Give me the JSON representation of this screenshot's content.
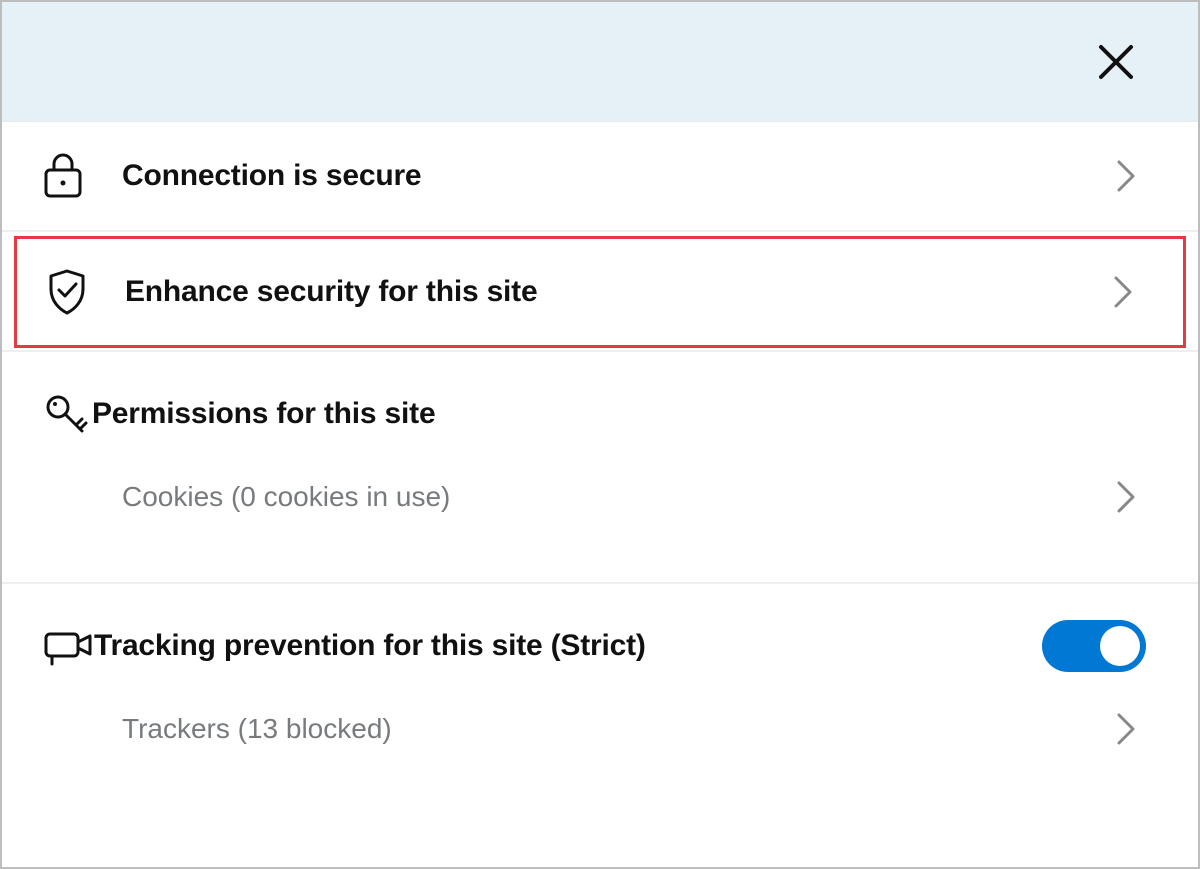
{
  "header": {},
  "rows": {
    "connection": {
      "label": "Connection is secure"
    },
    "enhance": {
      "label": "Enhance security for this site"
    },
    "permissions": {
      "label": "Permissions for this site"
    },
    "cookies": {
      "label": "Cookies (0 cookies in use)"
    },
    "tracking": {
      "label": "Tracking prevention for this site (Strict)",
      "toggle_on": true
    },
    "trackers": {
      "label": "Trackers (13 blocked)"
    }
  }
}
